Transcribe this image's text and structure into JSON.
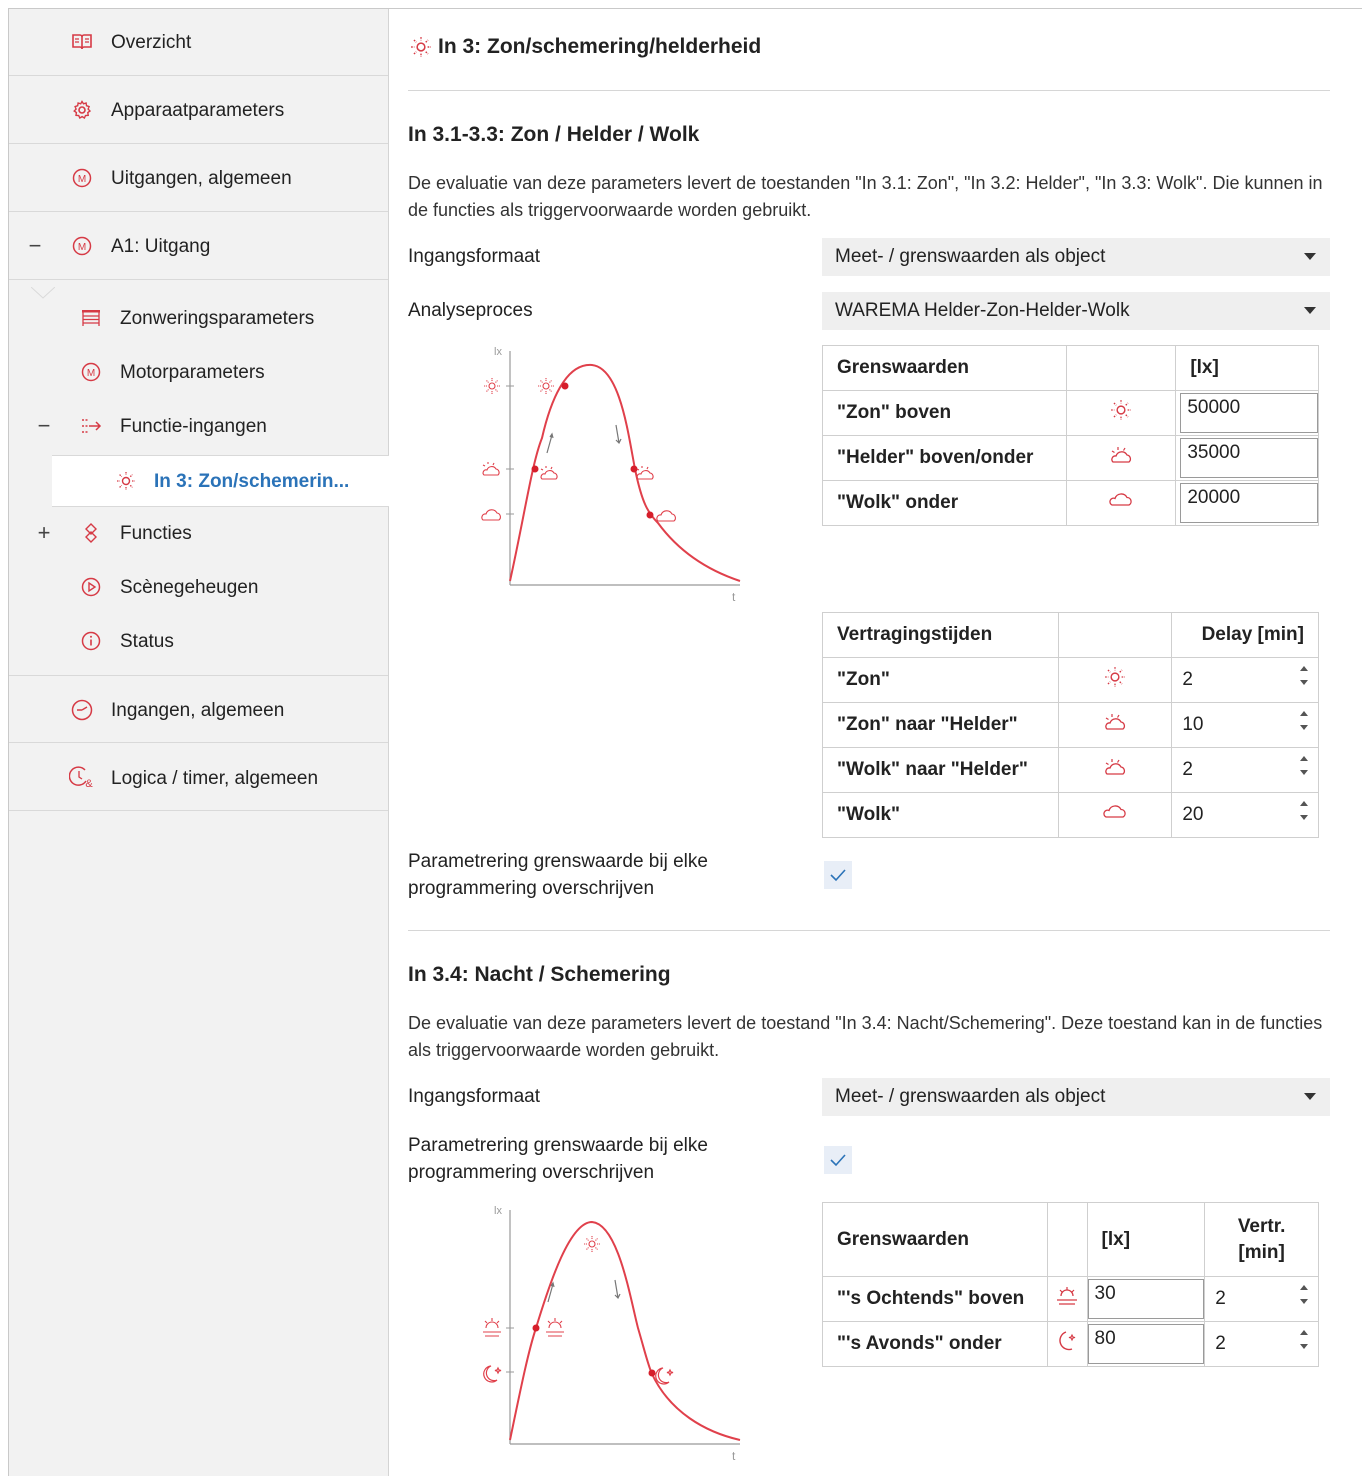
{
  "colors": {
    "accent": "#d63a45",
    "link": "#2b73b8",
    "sidebar_bg": "#f2f2f2"
  },
  "sidebar": {
    "items": [
      {
        "label": "Overzicht",
        "icon": "book-icon"
      },
      {
        "label": "Apparaatparameters",
        "icon": "gear-icon"
      },
      {
        "label": "Uitgangen, algemeen",
        "icon": "motor-icon"
      },
      {
        "label": "A1: Uitgang",
        "icon": "motor-icon",
        "expander": "−"
      },
      {
        "label": "Zonweringsparameters",
        "icon": "blind-icon"
      },
      {
        "label": "Motorparameters",
        "icon": "motor-icon"
      },
      {
        "label": "Functie-ingangen",
        "icon": "input-arrow-icon",
        "expander": "−"
      },
      {
        "label": "In 3: Zon/schemerin...",
        "icon": "sun-icon"
      },
      {
        "label": "Functies",
        "icon": "function-icon",
        "expander": "+"
      },
      {
        "label": "Scènegeheugen",
        "icon": "play-icon"
      },
      {
        "label": "Status",
        "icon": "info-icon"
      },
      {
        "label": "Ingangen, algemeen",
        "icon": "clock-icon"
      },
      {
        "label": "Logica / timer, algemeen",
        "icon": "logic-timer-icon"
      }
    ]
  },
  "main": {
    "title": "In 3: Zon/schemering/helderheid",
    "section1": {
      "title": "In 3.1-3.3: Zon / Helder / Wolk",
      "description": "De evaluatie van deze parameters levert de toestanden \"In 3.1: Zon\", \"In 3.2: Helder\", \"In 3.3: Wolk\". Die kunnen in de functies als triggervoorwaarde worden gebruikt.",
      "input_format_label": "Ingangsformaat",
      "input_format_value": "Meet- / grenswaarden als object",
      "analysis_label": "Analyseproces",
      "analysis_value": "WAREMA Helder-Zon-Helder-Wolk",
      "chart": {
        "y_axis": "lx",
        "x_axis": "t"
      },
      "thresholds": {
        "header": [
          "Grenswaarden",
          "",
          "[lx]"
        ],
        "rows": [
          {
            "label": "\"Zon\" boven",
            "icon": "sun-icon",
            "value": "50000"
          },
          {
            "label": "\"Helder\" boven/onder",
            "icon": "sun-cloud-icon",
            "value": "35000"
          },
          {
            "label": "\"Wolk\" onder",
            "icon": "cloud-icon",
            "value": "20000"
          }
        ]
      },
      "delays": {
        "header": [
          "Vertragingstijden",
          "",
          "Delay [min]"
        ],
        "rows": [
          {
            "label": "\"Zon\"",
            "icon": "sun-icon",
            "value": "2"
          },
          {
            "label": "\"Zon\" naar \"Helder\"",
            "icon": "sun-cloud-icon",
            "value": "10"
          },
          {
            "label": "\"Wolk\" naar \"Helder\"",
            "icon": "sun-cloud-icon",
            "value": "2"
          },
          {
            "label": "\"Wolk\"",
            "icon": "cloud-icon",
            "value": "20"
          }
        ]
      },
      "overwrite_label": "Parametrering grenswaarde bij elke programmering overschrijven",
      "overwrite_checked": true
    },
    "section2": {
      "title": "In 3.4: Nacht / Schemering",
      "description": "De evaluatie van deze parameters levert de toestand \"In 3.4: Nacht/Schemering\". Deze toestand kan in de functies als triggervoorwaarde worden gebruikt.",
      "input_format_label": "Ingangsformaat",
      "input_format_value": "Meet- / grenswaarden als object",
      "overwrite_label": "Parametrering grenswaarde bij elke programmering overschrijven",
      "overwrite_checked": true,
      "chart": {
        "y_axis": "lx",
        "x_axis": "t"
      },
      "thresholds": {
        "header": [
          "Grenswaarden",
          "",
          "[lx]",
          "Vertr. [min]"
        ],
        "rows": [
          {
            "label": "\"'s Ochtends\" boven",
            "icon": "sunrise-icon",
            "value": "30",
            "delay": "2"
          },
          {
            "label": "\"'s Avonds\" onder",
            "icon": "moon-icon",
            "value": "80",
            "delay": "2"
          }
        ]
      }
    }
  }
}
